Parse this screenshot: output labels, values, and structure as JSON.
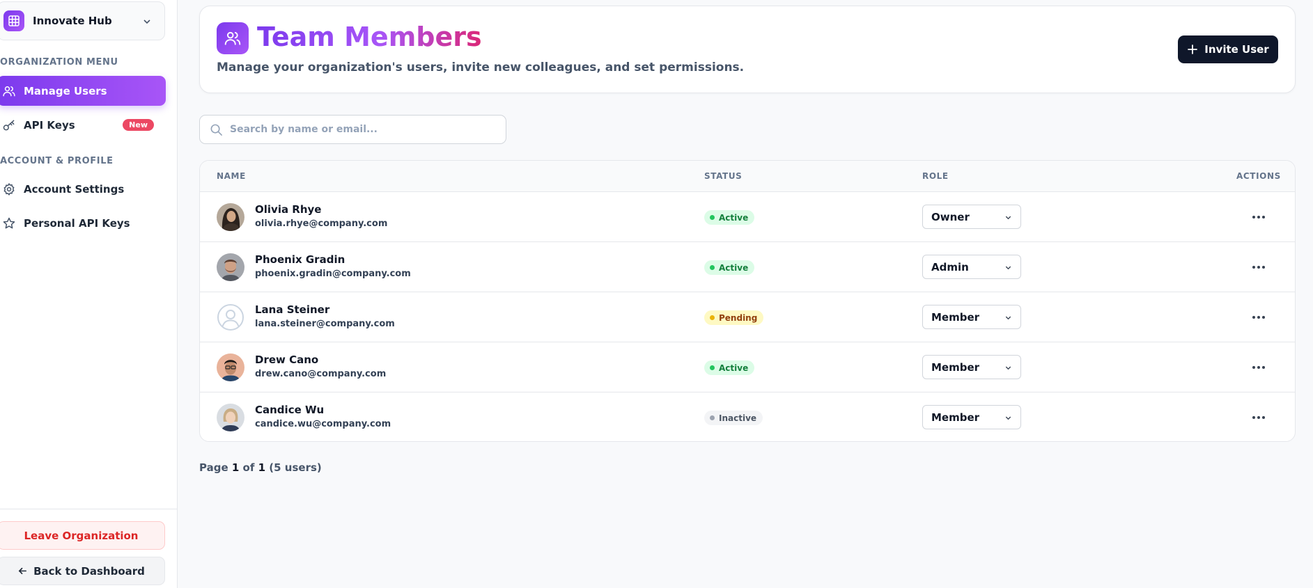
{
  "sidebar": {
    "org_name": "Innovate Hub",
    "sections": [
      {
        "label": "ORGANIZATION MENU"
      },
      {
        "label": "ACCOUNT & PROFILE"
      }
    ],
    "items": [
      {
        "label": "Manage Users",
        "icon": "users-icon",
        "active": true
      },
      {
        "label": "API Keys",
        "icon": "key-icon",
        "badge": "New"
      },
      {
        "label": "Account Settings",
        "icon": "gear-icon"
      },
      {
        "label": "Personal API Keys",
        "icon": "star-icon"
      }
    ],
    "leave_label": "Leave Organization",
    "back_label": "Back to Dashboard"
  },
  "header": {
    "title": "Team Members",
    "subtitle": "Manage your organization's users, invite new colleagues, and set permissions.",
    "invite_label": "Invite User"
  },
  "search": {
    "placeholder": "Search by name or email...",
    "value": ""
  },
  "table": {
    "columns": [
      "NAME",
      "STATUS",
      "ROLE",
      "ACTIONS"
    ],
    "rows": [
      {
        "name": "Olivia Rhye",
        "email": "olivia.rhye@company.com",
        "status": "Active",
        "role": "Owner"
      },
      {
        "name": "Phoenix Gradin",
        "email": "phoenix.gradin@company.com",
        "status": "Active",
        "role": "Admin"
      },
      {
        "name": "Lana Steiner",
        "email": "lana.steiner@company.com",
        "status": "Pending",
        "role": "Member"
      },
      {
        "name": "Drew Cano",
        "email": "drew.cano@company.com",
        "status": "Active",
        "role": "Member"
      },
      {
        "name": "Candice Wu",
        "email": "candice.wu@company.com",
        "status": "Inactive",
        "role": "Member"
      }
    ]
  },
  "pagination": {
    "prefix": "Page",
    "current": "1",
    "of": "of",
    "total": "1",
    "count": "(5 users)"
  },
  "colors": {
    "accent": "#7c3aed",
    "accent_light": "#a855f7",
    "title_end": "#db2777",
    "dark_button": "#0f172a",
    "danger": "#dc2626",
    "badge_new": "#ec4863"
  }
}
